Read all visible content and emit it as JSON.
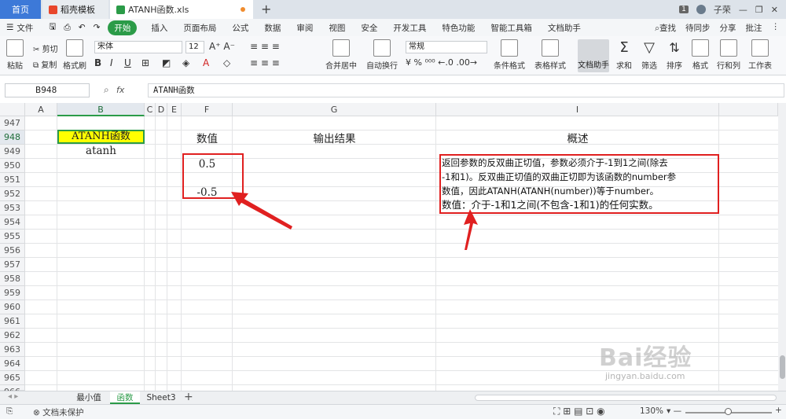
{
  "titlebar": {
    "home": "首页",
    "tab1": "稻壳模板",
    "tab2": "ATANH函数.xls",
    "badge": "1",
    "user": "子荣"
  },
  "menubar": {
    "file": "文件",
    "start": "开始",
    "items": [
      "插入",
      "页面布局",
      "公式",
      "数据",
      "审阅",
      "视图",
      "安全",
      "开发工具",
      "特色功能",
      "智能工具箱",
      "文档助手"
    ],
    "search": "查找",
    "sync": "待同步",
    "share": "分享",
    "comment": "批注"
  },
  "ribbon": {
    "paste": "粘贴",
    "cut": "剪切",
    "copy": "复制",
    "format_painter": "格式刷",
    "font": "宋体",
    "size": "12",
    "merge": "合并居中",
    "wrap": "自动换行",
    "number_format": "常规",
    "cond_format": "条件格式",
    "table_style": "表格样式",
    "doc_assist": "文档助手",
    "sum": "求和",
    "filter": "筛选",
    "sort": "排序",
    "format": "格式",
    "rowcol": "行和列",
    "worksheet": "工作表"
  },
  "formula": {
    "cell_ref": "B948",
    "fx": "fx",
    "content": "ATANH函数"
  },
  "columns": [
    "A",
    "B",
    "C",
    "D",
    "E",
    "F",
    "G",
    "I"
  ],
  "rows": [
    "947",
    "948",
    "949",
    "950",
    "951",
    "952",
    "953",
    "954",
    "955",
    "956",
    "957",
    "958",
    "959",
    "960",
    "961",
    "962",
    "963",
    "964",
    "965",
    "966"
  ],
  "cells": {
    "b948": "ATANH函数",
    "b949": "atanh",
    "f948": "数值",
    "g948": "输出结果",
    "i948": "概述",
    "f950": "0.5",
    "f952": "-0.5"
  },
  "description": {
    "line1": "返回参数的反双曲正切值，参数必须介于-1到1之间(除去",
    "line2": "-1和1)。反双曲正切值的双曲正切即为该函数的number参",
    "line3": "数值，因此ATANH(ATANH(number))等于number。",
    "line4": " 数值：介于-1和1之间(不包含-1和1)的任何实数。"
  },
  "sheets": [
    "最小值",
    "函数",
    "Sheet3"
  ],
  "status": {
    "protect": "文档未保护",
    "zoom": "130%"
  },
  "watermark": {
    "brand": "Bai经验",
    "url": "jingyan.baidu.com"
  },
  "colors": {
    "accent": "#2b9b48",
    "highlight": "#ffff00",
    "annotation": "#e02020",
    "home_tab": "#3d79d8"
  }
}
